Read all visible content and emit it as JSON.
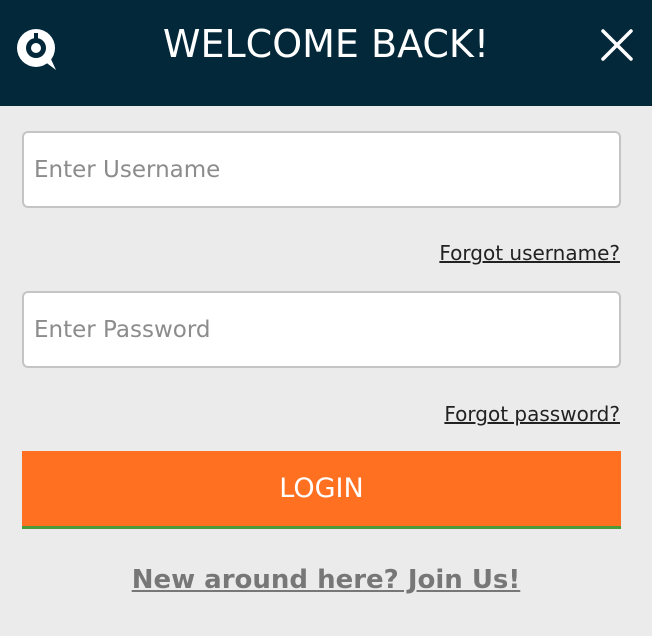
{
  "header": {
    "title": "WELCOME BACK!",
    "logo_icon": "speech-bubble-logo-icon",
    "close_icon": "close-icon",
    "background_color": "#03283a"
  },
  "form": {
    "username_placeholder": "Enter Username",
    "username_value": "",
    "forgot_username": "Forgot username?",
    "password_placeholder": "Enter Password",
    "password_value": "",
    "forgot_password": "Forgot password?",
    "login_label": "LOGIN",
    "login_color": "#ff7020"
  },
  "footer": {
    "join_label": "New around here? Join Us!"
  }
}
